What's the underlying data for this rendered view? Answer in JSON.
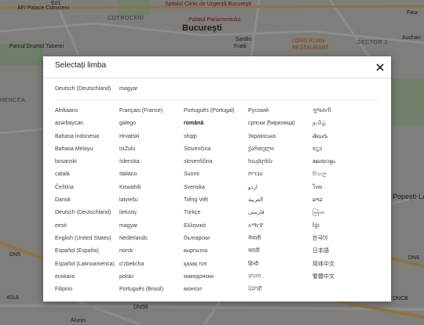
{
  "map": {
    "labels": {
      "afi": "AFI Palace Cotroceni",
      "spitalul": "Spitalul Clinic de Urgență București",
      "palatul": "Palatul Parlamentului",
      "bucuresti": "București",
      "cotroceni": "COTROCENI",
      "parcul": "Parcul Drumul Taberei",
      "sardin": "Sardin",
      "fratii": "Frații",
      "longkuan": "LONG KUAN",
      "restaurant": "RESTAURANT",
      "sector3": "SECTOR 3",
      "auchan": "Auchan",
      "faur": "Faur",
      "hencea": "HENCEA",
      "popesti": "Popești-Le",
      "road_e81": "E81",
      "road_dn5": "DN5",
      "road_dn6": "DN6",
      "road_401a": "401A",
      "road_dn5b": "DN5B",
      "road_dncb": "DNCB",
      "alunis": "Alunis"
    }
  },
  "dialog": {
    "title": "Selectați limba",
    "close_icon": "close-icon",
    "recent": [
      "Deutsch (Deutschland)",
      "magyar"
    ],
    "selected": "română",
    "columns": [
      [
        "Afrikaans",
        "azərbaycan",
        "Bahasa Indonesia",
        "Bahasa Melayu",
        "bosanski",
        "català",
        "Čeština",
        "Dansk",
        "Deutsch (Deutschland)",
        "eesti",
        "English (United States)",
        "Español (España)",
        "Español (Latinoamérica)",
        "euskara",
        "Filipino"
      ],
      [
        "Français (France)",
        "galego",
        "Hrvatski",
        "isiZulu",
        "íslenska",
        "Italiano",
        "Kiswahili",
        "latviešu",
        "lietuvių",
        "magyar",
        "Nederlands",
        "norsk",
        "o'zbekcha",
        "polski",
        "Português (Brasil)"
      ],
      [
        "Português (Portugal)",
        "română",
        "shqip",
        "Slovenčina",
        "slovenščina",
        "Suomi",
        "Svenska",
        "Tiếng Việt",
        "Türkçe",
        "Ελληνικά",
        "български",
        "кыргызча",
        "қазақ тілі",
        "македонски",
        "монгол"
      ],
      [
        "Русский",
        "српски (ћирилица)",
        "Українська",
        "ქართული",
        "հայերեն",
        "עברית",
        "اردو",
        "العربية",
        "فارسی",
        "አማርኛ",
        "नेपाली",
        "मराठी",
        "हिन्दी",
        "বাংলা",
        "ਪੰਜਾਬੀ"
      ],
      [
        "ગુજરાતી",
        "தமிழ்",
        "తెలుగు",
        "ಕನ್ನಡ",
        "മലയാളം",
        "සිංහල",
        "ไทย",
        "ລາວ",
        "မြန်မာ",
        "ខ្មែរ",
        "한국어",
        "日本語",
        "简体中文",
        "繁體中文"
      ]
    ]
  }
}
